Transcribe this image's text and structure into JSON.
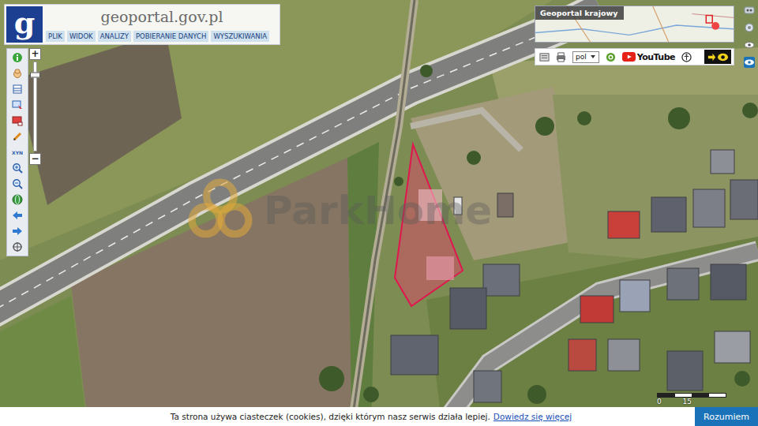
{
  "header": {
    "logo": "g",
    "site": "geoportal.gov.pl",
    "menu": [
      "PLIK",
      "WIDOK",
      "ANALIZY",
      "POBIERANIE DANYCH",
      "WYSZUKIWANIA"
    ]
  },
  "toolbar": {
    "zoom_in": "+",
    "zoom_out": "−",
    "coord_label": "XYN"
  },
  "zoom": {
    "level": 0.86
  },
  "overview": {
    "title": "Geoportal krajowy"
  },
  "top_bar": {
    "language": "pol",
    "youtube": "YouTube"
  },
  "watermark": "ParkHome",
  "scale": {
    "labels": [
      "0",
      "15"
    ]
  },
  "cookie": {
    "text": "Ta strona używa ciasteczek (cookies), dzięki którym nasz serwis działa lepiej.",
    "link": "Dowiedz się więcej",
    "button": "Rozumiem"
  }
}
